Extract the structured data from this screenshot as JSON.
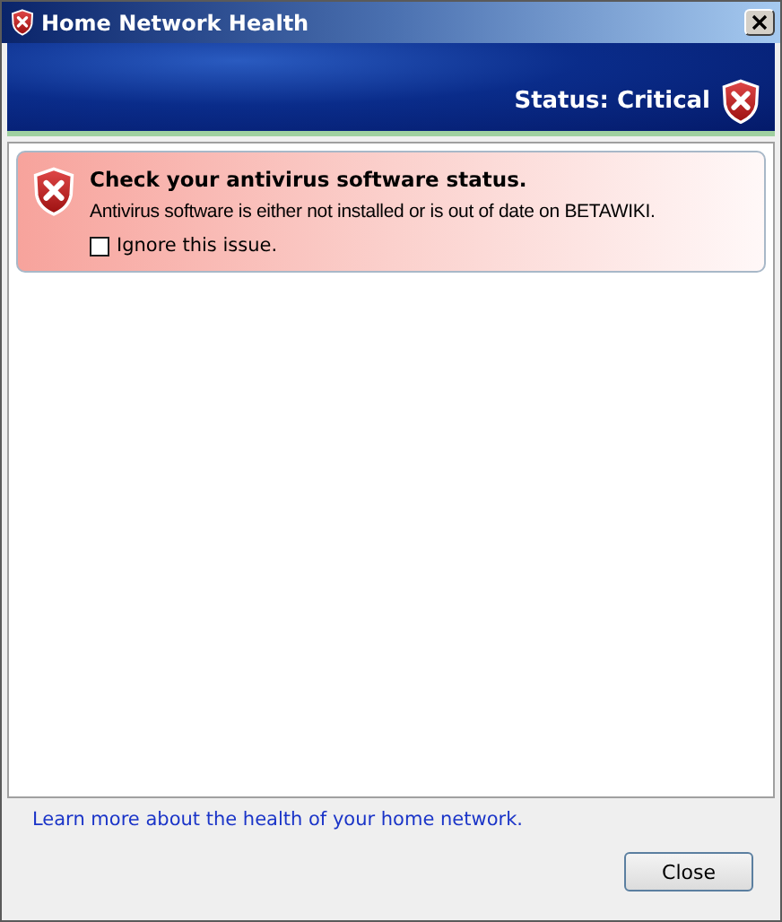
{
  "window": {
    "title": "Home Network Health"
  },
  "header": {
    "status": "Status: Critical",
    "kind": "critical"
  },
  "issues": [
    {
      "kind": "critical",
      "title": "Check your antivirus software status.",
      "description": "Antivirus software is either not installed or is out of date on BETAWIKI.",
      "ignore": {
        "label": "Ignore this issue.",
        "checked": false
      }
    }
  ],
  "footer": {
    "link": "Learn more about the health of your home network.",
    "buttons": [
      "Close"
    ]
  }
}
